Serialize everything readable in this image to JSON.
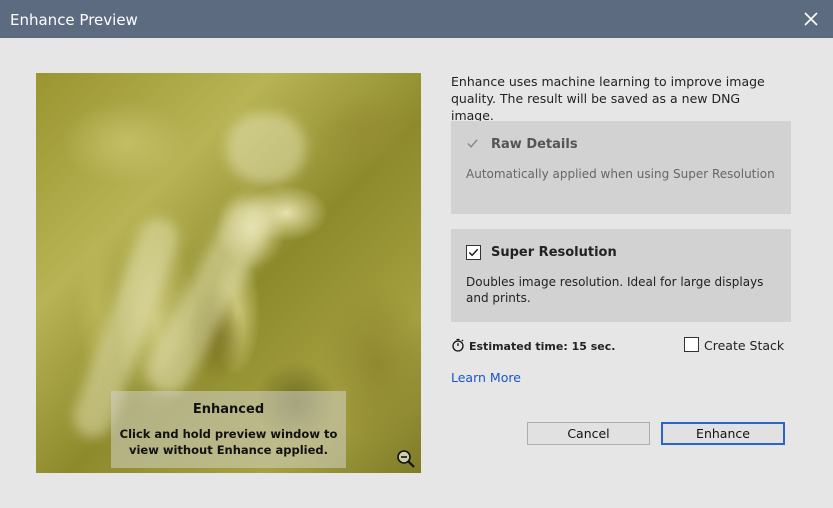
{
  "window": {
    "title": "Enhance Preview"
  },
  "preview": {
    "overlay_title": "Enhanced",
    "overlay_text": "Click and hold preview window to view without Enhance applied."
  },
  "description": "Enhance uses machine learning to improve image quality. The result will be saved as a new DNG image.",
  "raw_details": {
    "label": "Raw Details",
    "text": "Automatically applied when using Super Resolution",
    "checked": true,
    "disabled": true
  },
  "super_resolution": {
    "label": "Super Resolution",
    "text": "Doubles image resolution. Ideal for large displays and prints.",
    "checked": true
  },
  "estimate": {
    "label": "Estimated time: 15 sec."
  },
  "create_stack": {
    "label": "Create Stack",
    "checked": false
  },
  "learn_more": "Learn More",
  "buttons": {
    "cancel": "Cancel",
    "enhance": "Enhance"
  },
  "colors": {
    "titlebar": "#5c6b80",
    "link": "#1a55c9",
    "primary_border": "#2b64c8"
  }
}
